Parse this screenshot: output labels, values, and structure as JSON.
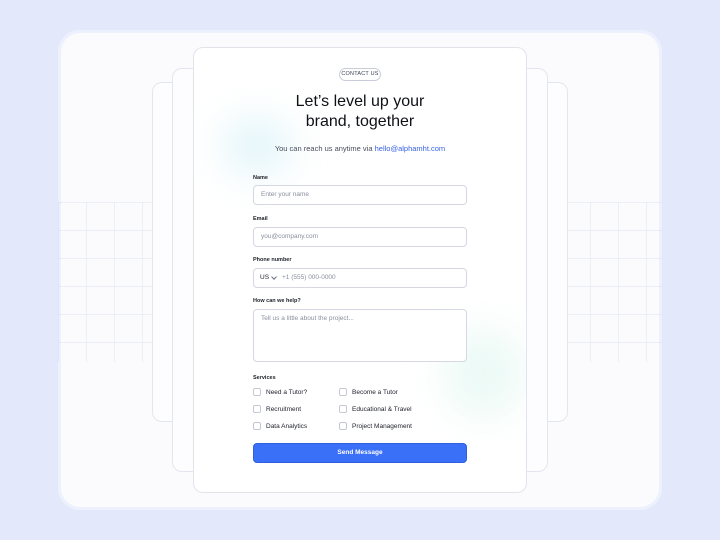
{
  "badge": "CONTACT US",
  "title_line1": "Let’s level up your",
  "title_line2": "brand, together",
  "subtitle_prefix": "You can reach us anytime via",
  "subtitle_email": "hello@alphamht.com",
  "form": {
    "name": {
      "label": "Name",
      "placeholder": "Enter your name"
    },
    "email": {
      "label": "Email",
      "placeholder": "you@company.com"
    },
    "phone": {
      "label": "Phone number",
      "country": "US",
      "placeholder": "+1 (555) 000-0000"
    },
    "message": {
      "label": "How can we help?",
      "placeholder": "Tell us a little about the project..."
    },
    "services_label": "Services",
    "services": [
      {
        "label": "Need a Tutor?",
        "checked": false
      },
      {
        "label": "Become a Tutor",
        "checked": false
      },
      {
        "label": "Recruitment",
        "checked": false
      },
      {
        "label": "Educational & Travel",
        "checked": false
      },
      {
        "label": "Data Analytics",
        "checked": false
      },
      {
        "label": "Project Management",
        "checked": false
      }
    ],
    "submit_label": "Send Message"
  },
  "colors": {
    "accent": "#3a6ff7",
    "link": "#3762e6",
    "page_bg": "#e3e8fb"
  }
}
